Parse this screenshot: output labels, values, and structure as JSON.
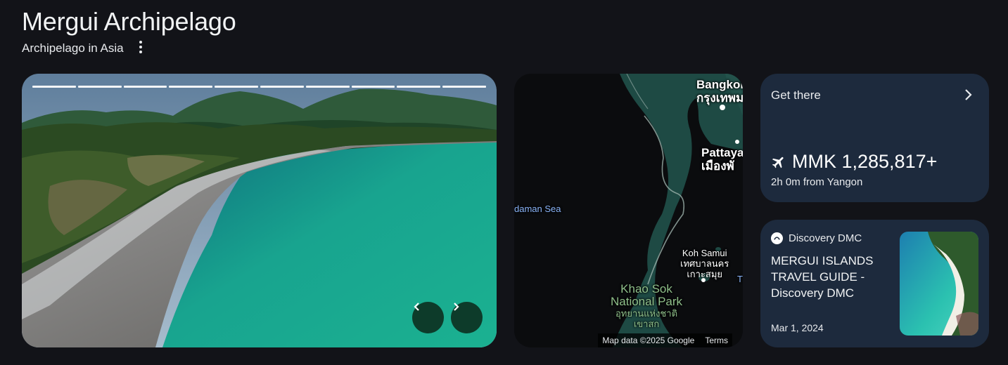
{
  "header": {
    "title": "Mergui Archipelago",
    "subtitle": "Archipelago in Asia"
  },
  "carousel": {
    "slide_count": 10,
    "current_slide": 1,
    "prev_icon": "chevron-left-icon",
    "next_icon": "chevron-right-icon"
  },
  "map": {
    "labels": {
      "bangkok_en": "Bangkok",
      "bangkok_th": "กรุงเทพมหา",
      "pattaya_en": "Pattaya",
      "pattaya_th": "เมืองพั",
      "andaman_sea": "daman Sea",
      "koh_samui_en": "Koh Samui",
      "koh_samui_th1": "เทศบาลนคร",
      "koh_samui_th2": "เกาะสมุย",
      "park_en1": "Khao Sok",
      "park_en2": "National Park",
      "park_th1": "อุทยานแห่งชาติ",
      "park_th2": "เขาสก",
      "edge_t": "T"
    },
    "attribution": "Map data ©2025 Google",
    "terms": "Terms"
  },
  "get_there": {
    "title": "Get there",
    "price": "MMK 1,285,817+",
    "detail": "2h 0m from Yangon",
    "icon": "airplane-icon"
  },
  "article": {
    "source": "Discovery DMC",
    "headline": "MERGUI ISLANDS TRAVEL GUIDE - Discovery DMC",
    "date": "Mar 1, 2024"
  },
  "colors": {
    "background": "#121318",
    "card": "#1d2a3d",
    "nav_button": "#0d3b2a",
    "map_land": "#1e4a44",
    "map_water": "#0b0c0e"
  }
}
